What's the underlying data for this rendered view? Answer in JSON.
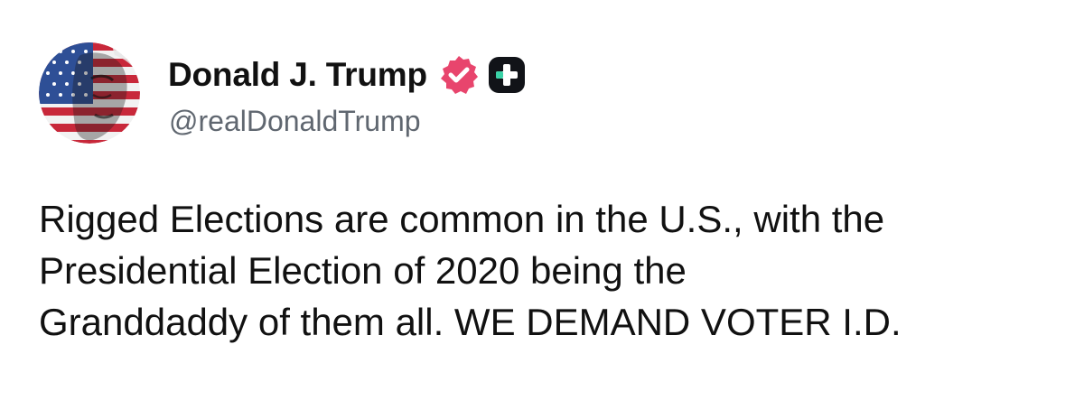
{
  "post": {
    "author": {
      "display_name": "Donald J. Trump",
      "handle": "@realDonaldTrump",
      "avatar_icon": "flag-portrait-avatar",
      "verified_icon": "verified-badge-icon",
      "plus_icon": "plus-badge-icon"
    },
    "text_lines": [
      "Rigged Elections are common in the U.S., with the",
      "Presidential Election of 2020 being the",
      "Granddaddy of them all. WE DEMAND VOTER I.D."
    ]
  },
  "colors": {
    "verified_badge": "#e8456d",
    "plus_badge_bg": "#111318",
    "plus_badge_accent": "#39d1a6",
    "handle_text": "#606770"
  }
}
